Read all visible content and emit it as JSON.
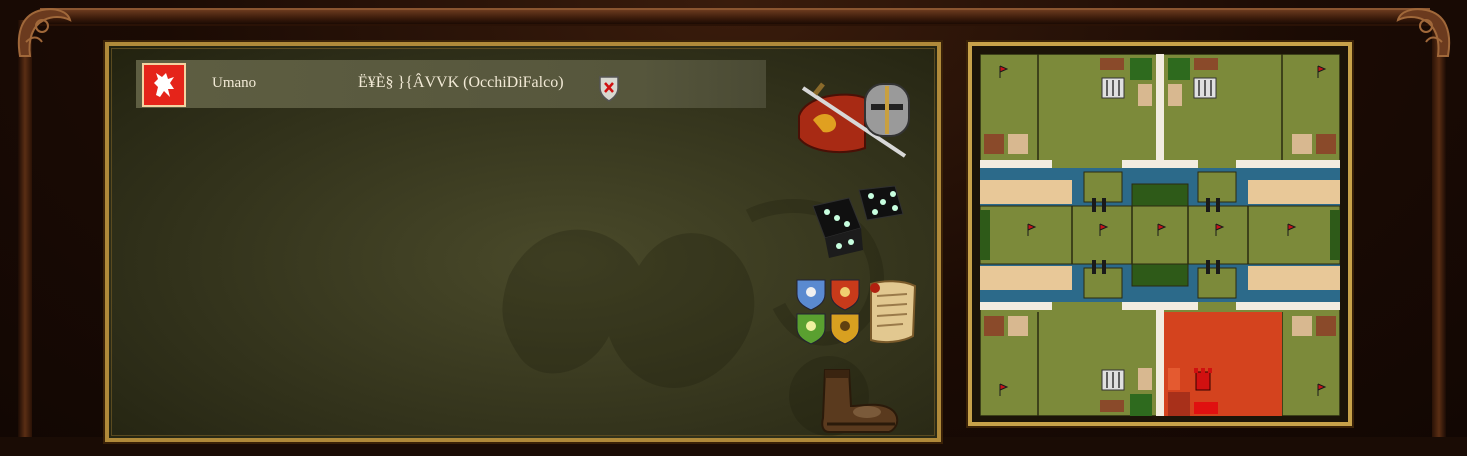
{
  "lobby": {
    "players": [
      {
        "type": "Umano",
        "name": "Ë¥È§ }{ÂVVK (OcchiDiFalco)",
        "color": "#e5241a"
      }
    ]
  },
  "icons": {
    "battle": "battle-helmet-sword-icon",
    "random": "dice-icon",
    "teams": "team-shields-icon",
    "scenario": "scroll-icon",
    "kick": "boot-icon",
    "remove_player": "red-x-shield-icon"
  },
  "map": {
    "grass_color": "#7c8a3a",
    "water_color": "#2c6a8a",
    "sand_color": "#e8c898",
    "player_territory_color": "#d4431e",
    "flag_color": "#c8141a"
  }
}
